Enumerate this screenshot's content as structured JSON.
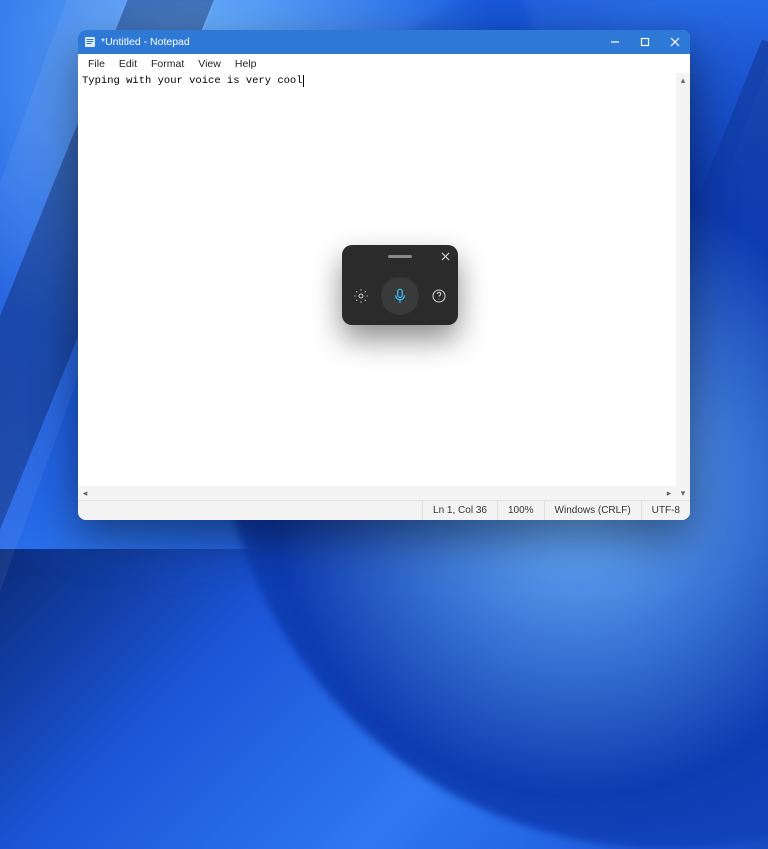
{
  "window": {
    "title": "*Untitled - Notepad"
  },
  "menu": {
    "file": "File",
    "edit": "Edit",
    "format": "Format",
    "view": "View",
    "help": "Help"
  },
  "editor": {
    "content": "Typing with your voice is very cool"
  },
  "status": {
    "pos": "Ln 1, Col 36",
    "zoom": "100%",
    "eol": "Windows (CRLF)",
    "encoding": "UTF-8"
  }
}
